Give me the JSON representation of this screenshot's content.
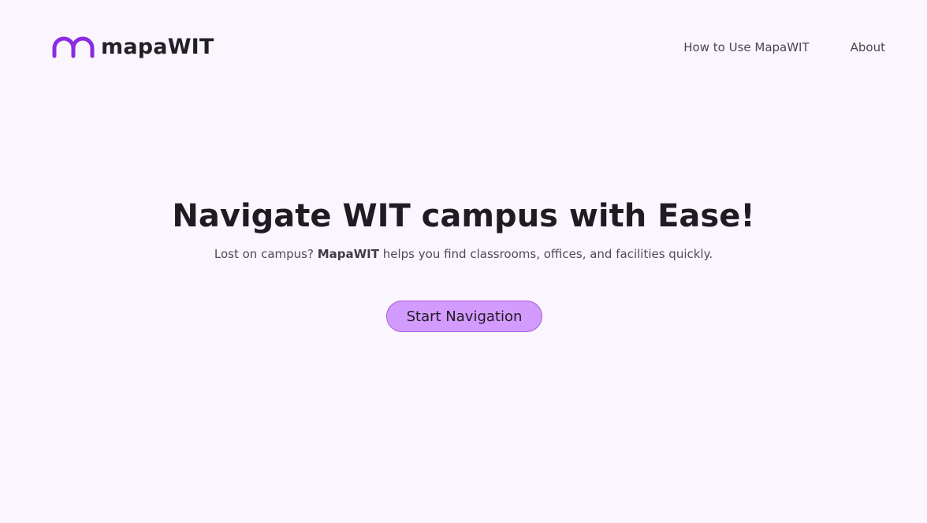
{
  "header": {
    "brand_name": "mapaWIT",
    "nav": [
      {
        "label": "How to Use MapaWIT"
      },
      {
        "label": "About"
      }
    ]
  },
  "hero": {
    "title": "Navigate WIT campus with Ease!",
    "subtitle_before": "Lost on campus? ",
    "subtitle_emphasis": "MapaWIT",
    "subtitle_after": " helps you find classrooms, offices, and facilities quickly.",
    "cta_label": "Start Navigation"
  },
  "colors": {
    "background": "#fbf6fd",
    "brand_purple": "#8b2be2",
    "cta_fill": "#d49bff",
    "cta_border": "#a35bd9"
  },
  "icons": {
    "brand_logo": "arch-m-logo-icon"
  }
}
